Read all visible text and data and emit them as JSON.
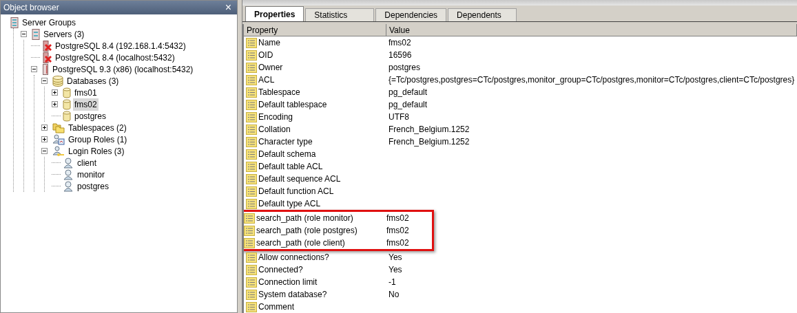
{
  "object_browser": {
    "title": "Object browser",
    "close": "×",
    "tree": [
      {
        "label": "Server Groups",
        "kind": "server-group",
        "children": [
          {
            "label": "Servers (3)",
            "kind": "servers",
            "expanded": true,
            "children": [
              {
                "label": "PostgreSQL 8.4 (192.168.1.4:5432)",
                "kind": "server-down"
              },
              {
                "label": "PostgreSQL 8.4 (localhost:5432)",
                "kind": "server-down"
              },
              {
                "label": "PostgreSQL 9.3 (x86) (localhost:5432)",
                "kind": "server",
                "expanded": true,
                "children": [
                  {
                    "label": "Databases (3)",
                    "kind": "databases",
                    "expanded": true,
                    "children": [
                      {
                        "label": "fms01",
                        "kind": "database",
                        "expanded": false,
                        "selected": false
                      },
                      {
                        "label": "fms02",
                        "kind": "database",
                        "expanded": false,
                        "selected": true
                      },
                      {
                        "label": "postgres",
                        "kind": "database",
                        "selected": false
                      }
                    ]
                  },
                  {
                    "label": "Tablespaces (2)",
                    "kind": "tablespaces",
                    "expanded": false
                  },
                  {
                    "label": "Group Roles (1)",
                    "kind": "group-roles",
                    "expanded": false
                  },
                  {
                    "label": "Login Roles (3)",
                    "kind": "login-roles",
                    "expanded": true,
                    "children": [
                      {
                        "label": "client",
                        "kind": "role"
                      },
                      {
                        "label": "monitor",
                        "kind": "role"
                      },
                      {
                        "label": "postgres",
                        "kind": "role"
                      }
                    ]
                  }
                ]
              }
            ]
          }
        ]
      }
    ]
  },
  "tabs": [
    {
      "label": "Properties",
      "selected": true
    },
    {
      "label": "Statistics",
      "selected": false
    },
    {
      "label": "Dependencies",
      "selected": false
    },
    {
      "label": "Dependents",
      "selected": false
    }
  ],
  "table": {
    "columns": [
      "Property",
      "Value"
    ],
    "rows": [
      {
        "property": "Name",
        "value": "fms02",
        "highlighted": false
      },
      {
        "property": "OID",
        "value": "16596",
        "highlighted": false
      },
      {
        "property": "Owner",
        "value": "postgres",
        "highlighted": false
      },
      {
        "property": "ACL",
        "value": "{=Tc/postgres,postgres=CTc/postgres,monitor_group=CTc/postgres,monitor=CTc/postgres,client=CTc/postgres}",
        "highlighted": false
      },
      {
        "property": "Tablespace",
        "value": "pg_default",
        "highlighted": false
      },
      {
        "property": "Default tablespace",
        "value": "pg_default",
        "highlighted": false
      },
      {
        "property": "Encoding",
        "value": "UTF8",
        "highlighted": false
      },
      {
        "property": "Collation",
        "value": "French_Belgium.1252",
        "highlighted": false
      },
      {
        "property": "Character type",
        "value": "French_Belgium.1252",
        "highlighted": false
      },
      {
        "property": "Default schema",
        "highlighted": false
      },
      {
        "property": "Default table ACL",
        "highlighted": false
      },
      {
        "property": "Default sequence ACL",
        "highlighted": false
      },
      {
        "property": "Default function ACL",
        "highlighted": false
      },
      {
        "property": "Default type ACL",
        "highlighted": false
      },
      {
        "property": "search_path (role monitor)",
        "value": "fms02",
        "highlighted": true
      },
      {
        "property": "search_path (role postgres)",
        "value": "fms02",
        "highlighted": true
      },
      {
        "property": "search_path (role client)",
        "value": "fms02",
        "highlighted": true
      },
      {
        "property": "Allow connections?",
        "value": "Yes",
        "highlighted": false
      },
      {
        "property": "Connected?",
        "value": "Yes",
        "highlighted": false
      },
      {
        "property": "Connection limit",
        "value": "-1",
        "highlighted": false
      },
      {
        "property": "System database?",
        "value": "No",
        "highlighted": false
      },
      {
        "property": "Comment",
        "highlighted": false
      }
    ]
  }
}
